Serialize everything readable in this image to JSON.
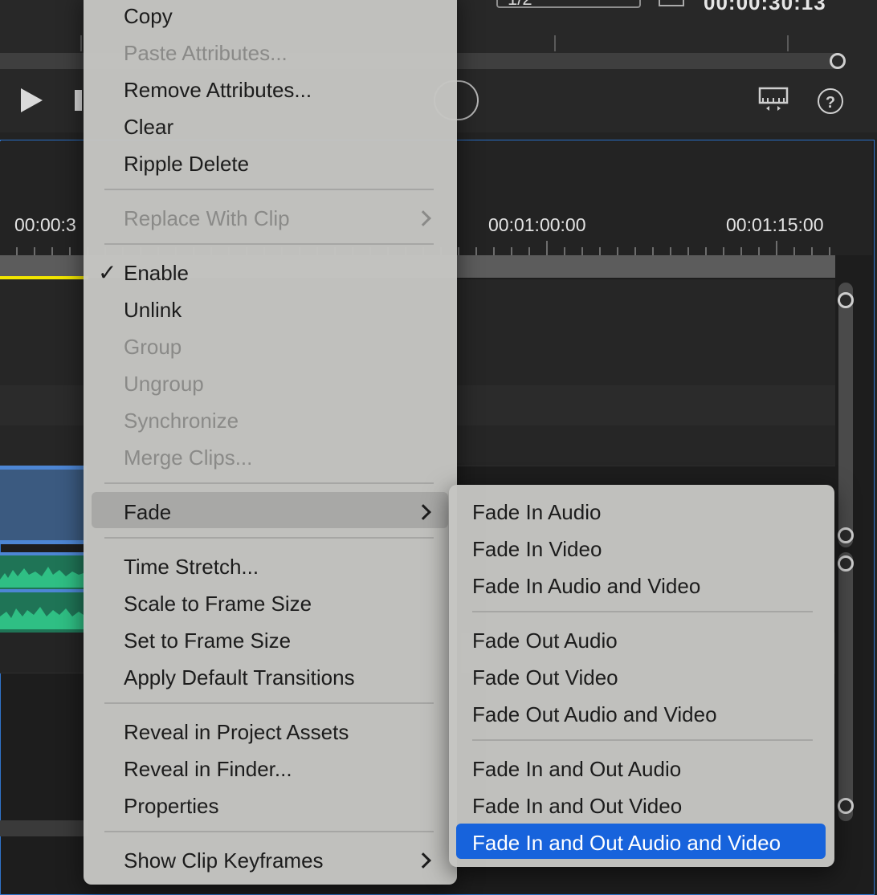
{
  "monitor": {
    "zoom_value": "1/2",
    "timecode": "00:00:30:13",
    "help_symbol": "?",
    "icons": [
      "play-icon",
      "step-forward-icon",
      "export-frame-icon",
      "help-icon",
      "fit-icon"
    ]
  },
  "timeline": {
    "timecodes": [
      "00:00:3",
      "00:01:00:00",
      "00:01:15:00"
    ],
    "playhead_color": "#f2e600",
    "panel_border_color": "#2f73c9"
  },
  "context_menu": {
    "items": [
      {
        "label": "Copy",
        "enabled": true
      },
      {
        "label": "Paste Attributes...",
        "enabled": false
      },
      {
        "label": "Remove Attributes...",
        "enabled": true
      },
      {
        "label": "Clear",
        "enabled": true
      },
      {
        "label": "Ripple Delete",
        "enabled": true
      },
      {
        "label": "Replace With Clip",
        "enabled": false,
        "submenu": true
      },
      {
        "label": "Enable",
        "enabled": true,
        "checked": true
      },
      {
        "label": "Unlink",
        "enabled": true
      },
      {
        "label": "Group",
        "enabled": false
      },
      {
        "label": "Ungroup",
        "enabled": false
      },
      {
        "label": "Synchronize",
        "enabled": false
      },
      {
        "label": "Merge Clips...",
        "enabled": false
      },
      {
        "label": "Fade",
        "enabled": true,
        "submenu": true,
        "highlighted": true
      },
      {
        "label": "Time Stretch...",
        "enabled": true
      },
      {
        "label": "Scale to Frame Size",
        "enabled": true
      },
      {
        "label": "Set to Frame Size",
        "enabled": true
      },
      {
        "label": "Apply Default Transitions",
        "enabled": true
      },
      {
        "label": "Reveal in Project Assets",
        "enabled": true
      },
      {
        "label": "Reveal in Finder...",
        "enabled": true
      },
      {
        "label": "Properties",
        "enabled": true
      },
      {
        "label": "Show Clip Keyframes",
        "enabled": true,
        "submenu": true
      }
    ],
    "checkmark": "✓"
  },
  "fade_submenu": {
    "items": [
      {
        "label": "Fade In Audio"
      },
      {
        "label": "Fade In Video"
      },
      {
        "label": "Fade In Audio and Video"
      },
      {
        "label": "Fade Out Audio"
      },
      {
        "label": "Fade Out Video"
      },
      {
        "label": "Fade Out Audio and Video"
      },
      {
        "label": "Fade In and Out Audio"
      },
      {
        "label": "Fade In and Out Video"
      },
      {
        "label": "Fade In and Out Audio and Video",
        "highlighted": true
      }
    ],
    "highlight_color": "#1763dc"
  }
}
